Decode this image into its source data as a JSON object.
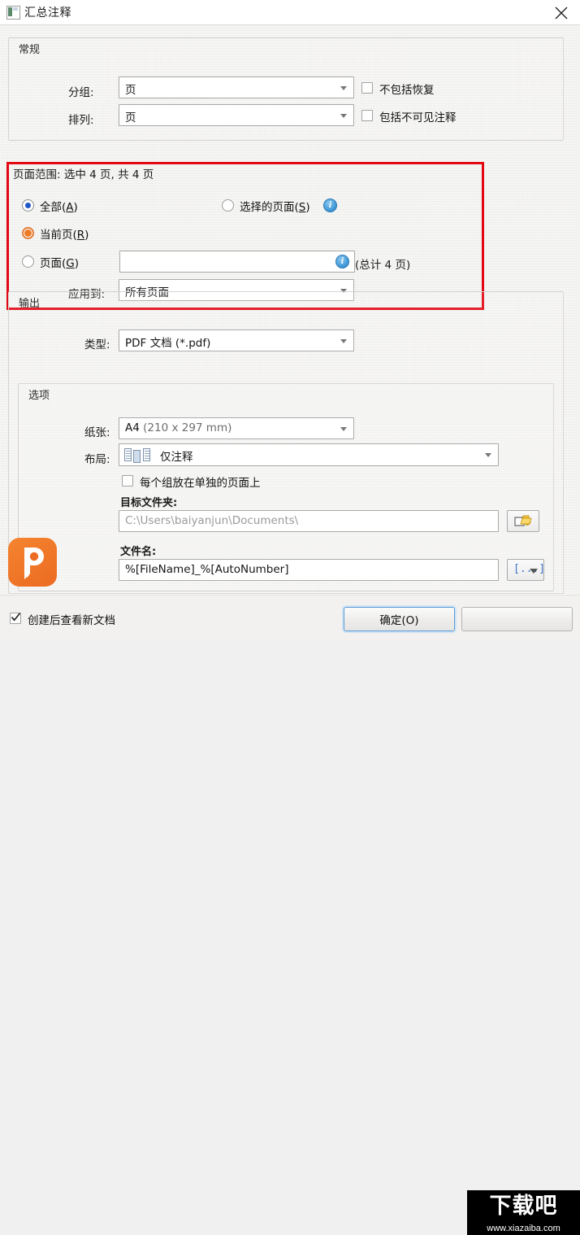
{
  "window": {
    "title": "汇总注释",
    "icon": "document-icon",
    "close_label": "×"
  },
  "general": {
    "legend": "常规",
    "group_label": "分组:",
    "group_value": "页",
    "sort_label": "排列:",
    "sort_value": "页",
    "checkbox_exclude_reply": "不包括恢复",
    "checkbox_exclude_reply_checked": false,
    "checkbox_include_hidden": "包括不可见注释",
    "checkbox_include_hidden_checked": false
  },
  "page_range": {
    "title": "页面范围: 选中 4 页, 共 4 页",
    "highlight_color": "#e30613",
    "radio_all": "全部(A)",
    "radio_all_selected": true,
    "radio_current": "当前页(R)",
    "radio_current_hover": true,
    "radio_pages": "页面(G)",
    "radio_pages_selected": false,
    "radio_selected_pages": "选择的页面(S)",
    "radio_selected_pages_selected": false,
    "pages_input_value": "",
    "pages_total_note": "(总计 4 页)",
    "apply_to_label": "应用到:",
    "apply_to_value": "所有页面",
    "info_icon": "info-icon"
  },
  "output": {
    "legend": "输出",
    "type_label": "类型:",
    "type_value": "PDF 文档 (*.pdf)"
  },
  "options": {
    "legend": "选项",
    "paper_label": "纸张:",
    "paper_value_main": "A4",
    "paper_value_dim": "(210 x 297 mm)",
    "layout_label": "布局:",
    "layout_value": "仅注释",
    "layout_icon": "pages-layout-icon",
    "checkbox_separate_page": "每个组放在单独的页面上",
    "checkbox_separate_page_checked": false,
    "dest_folder_label": "目标文件夹:",
    "dest_folder_value": "C:\\Users\\baiyanjun\\Documents\\",
    "browse_icon": "folder-browse-icon",
    "filename_label": "文件名:",
    "filename_value": "%[FileName]_%[AutoNumber]",
    "macro_button_label": "[...]"
  },
  "footer": {
    "checkbox_view_after": "创建后查看新文档",
    "checkbox_view_after_checked": true,
    "ok_button": "确定(O)",
    "cancel_button": ""
  },
  "watermark": {
    "logo_text": "下载吧",
    "url_text": "www.xiazaiba.com"
  },
  "app_logo": {
    "name": "pdf-xchange-logo",
    "color": "#ec6b22"
  }
}
